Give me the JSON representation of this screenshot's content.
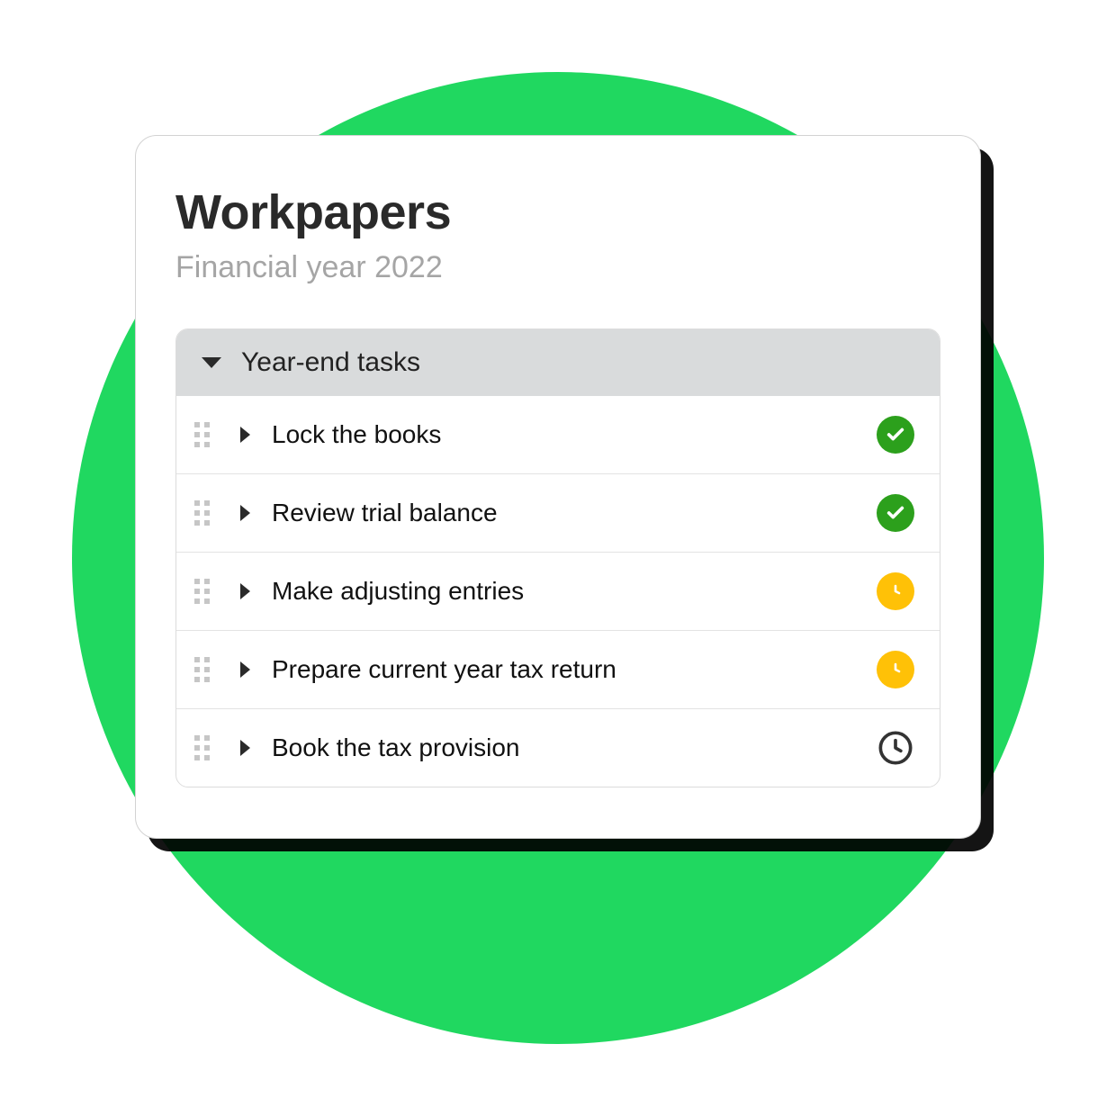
{
  "header": {
    "title": "Workpapers",
    "subtitle": "Financial year 2022"
  },
  "section": {
    "title": "Year-end tasks"
  },
  "tasks": [
    {
      "label": "Lock the books",
      "status": "done"
    },
    {
      "label": "Review trial balance",
      "status": "done"
    },
    {
      "label": "Make adjusting entries",
      "status": "pending"
    },
    {
      "label": "Prepare current year tax return",
      "status": "pending"
    },
    {
      "label": "Book the tax provision",
      "status": "not_started"
    }
  ],
  "colors": {
    "accent_bg": "#20d860",
    "done": "#2ca01c",
    "pending": "#ffc107",
    "outline": "#333333"
  }
}
